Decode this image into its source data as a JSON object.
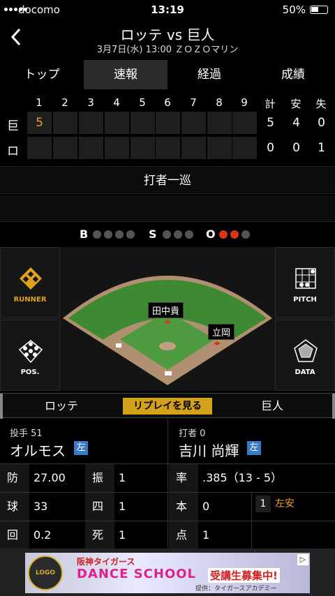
{
  "status": {
    "carrier": "docomo",
    "time": "13:19",
    "battery": "50%"
  },
  "header": {
    "title": "ロッテ vs 巨人",
    "subtitle": "3月7日(水) 13:00 ＺＯＺＯマリン"
  },
  "tabs": [
    {
      "label": "トップ",
      "active": false
    },
    {
      "label": "速報",
      "active": true
    },
    {
      "label": "経過",
      "active": false
    },
    {
      "label": "成績",
      "active": false
    }
  ],
  "scoreboard": {
    "innings": [
      "1",
      "2",
      "3",
      "4",
      "5",
      "6",
      "7",
      "8",
      "9"
    ],
    "totals_labels": [
      "計",
      "安",
      "失"
    ],
    "teams": [
      {
        "abbr": "巨",
        "runs": [
          "5",
          "",
          "",
          "",
          "",
          "",
          "",
          "",
          ""
        ],
        "R": "5",
        "H": "4",
        "E": "0"
      },
      {
        "abbr": "ロ",
        "runs": [
          "",
          "",
          "",
          "",
          "",
          "",
          "",
          "",
          ""
        ],
        "R": "0",
        "H": "0",
        "E": "1"
      }
    ]
  },
  "banner": {
    "text": "打者一巡",
    "sub": ""
  },
  "count": {
    "b_label": "B",
    "s_label": "S",
    "o_label": "O",
    "balls": 0,
    "strikes": 0,
    "outs": 2,
    "on_color": "#d8351c",
    "off_color": "#555555"
  },
  "side_buttons": {
    "runner": "RUNNER",
    "pos": "POS.",
    "pitch": "PITCH",
    "data": "DATA"
  },
  "fielders": {
    "center": "田中貴",
    "right": "立岡"
  },
  "team_bar": {
    "home": "ロッテ",
    "replay": "リプレイを見る",
    "away": "巨人"
  },
  "pitcher": {
    "role": "投手 51",
    "name": "オルモス",
    "hand": "左"
  },
  "batter": {
    "role": "打者 0",
    "name": "吉川 尚輝",
    "hand": "左"
  },
  "stats": {
    "era_label": "防",
    "era": "27.00",
    "k_label": "振",
    "k": "1",
    "pitches_label": "球",
    "pitches": "33",
    "bb_label": "四",
    "bb": "1",
    "ip_label": "回",
    "ip": "0.2",
    "hbp_label": "死",
    "hbp": "1",
    "avg_label": "率",
    "avg": ".385（13 - 5）",
    "hr_label": "本",
    "hr": "0",
    "rbi_label": "点",
    "rbi": "1"
  },
  "at_bat_result": {
    "num": "1",
    "result": "左安"
  },
  "ad": {
    "logo": "LOGO",
    "line1": "阪神タイガース",
    "line2": "DANCE SCHOOL",
    "line3": "受講生募集中!",
    "line4": "提供：タイガースアカデミー"
  }
}
